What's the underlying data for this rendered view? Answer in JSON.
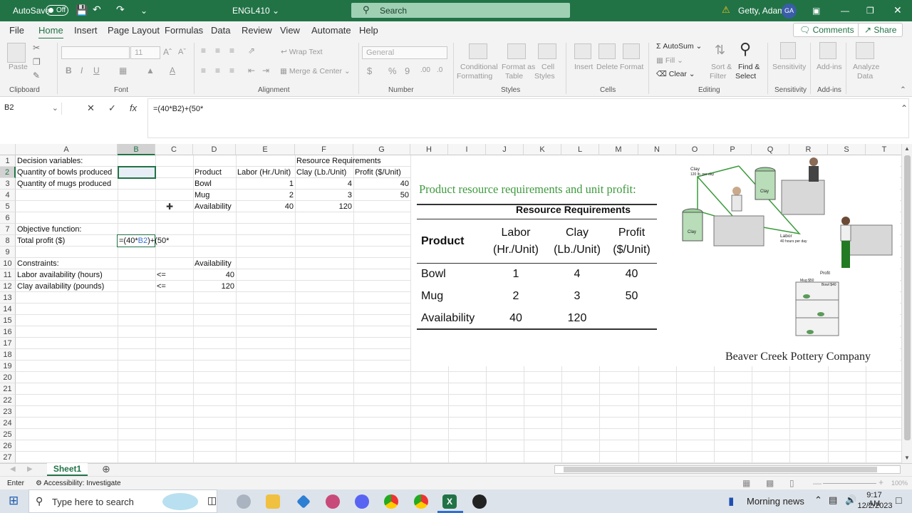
{
  "titlebar": {
    "autosave_label": "AutoSave",
    "autosave_state": "Off",
    "filename": "ENGL410",
    "search_placeholder": "Search",
    "user_name": "Getty, Adam",
    "user_initials": "GA"
  },
  "menu": {
    "items": [
      "File",
      "Home",
      "Insert",
      "Page Layout",
      "Formulas",
      "Data",
      "Review",
      "View",
      "Automate",
      "Help"
    ],
    "active": "Home",
    "comments": "Comments",
    "share": "Share"
  },
  "ribbon": {
    "clipboard": {
      "paste": "Paste",
      "group": "Clipboard"
    },
    "font": {
      "size": "11",
      "group": "Font"
    },
    "alignment": {
      "wrap": "Wrap Text",
      "merge": "Merge & Center",
      "group": "Alignment"
    },
    "number": {
      "format": "General",
      "group": "Number"
    },
    "styles": {
      "conditional": "Conditional",
      "conditional2": "Formatting",
      "format_as": "Format as",
      "format_as2": "Table",
      "cell_styles": "Cell",
      "cell_styles2": "Styles",
      "group": "Styles"
    },
    "cells": {
      "insert": "Insert",
      "delete": "Delete",
      "format": "Format",
      "group": "Cells"
    },
    "editing": {
      "autosum": "AutoSum",
      "fill": "Fill",
      "clear": "Clear",
      "sort": "Sort &",
      "sort2": "Filter",
      "find": "Find &",
      "find2": "Select",
      "group": "Editing"
    },
    "sensitivity": {
      "label": "Sensitivity",
      "group": "Sensitivity"
    },
    "addins": {
      "label": "Add-ins",
      "group": "Add-ins"
    },
    "analyze": {
      "label": "Analyze",
      "label2": "Data"
    }
  },
  "formula_bar": {
    "name_box": "B2",
    "formula": "=(40*B2)+(50*"
  },
  "columns": [
    "A",
    "B",
    "C",
    "D",
    "E",
    "F",
    "G",
    "H",
    "I",
    "J",
    "K",
    "L",
    "M",
    "N",
    "O",
    "P",
    "Q",
    "R",
    "S",
    "T"
  ],
  "rows": [
    "1",
    "2",
    "3",
    "4",
    "5",
    "6",
    "7",
    "8",
    "9",
    "10",
    "11",
    "12",
    "13",
    "14",
    "15",
    "16",
    "17",
    "18",
    "19",
    "20",
    "21",
    "22",
    "23",
    "24",
    "25",
    "26",
    "27"
  ],
  "cells": {
    "A1": "Decision variables:",
    "A2": "Quantity of bowls produced",
    "A3": "Quantity of mugs produced",
    "A7": "Objective function:",
    "A8": "Total profit ($)",
    "B8_pre": "=(40*",
    "B8_ref": "B2",
    "B8_post": ")+(50*",
    "A10": "Constraints:",
    "A11": "Labor availability (hours)",
    "A12": "Clay availability (pounds)",
    "C11": "<=",
    "C12": "<=",
    "D10": "Availability",
    "D11": "40",
    "D12": "120",
    "E1": "Resource Requirements",
    "D2": "Product",
    "E2": "Labor (Hr./Unit)",
    "F2": "Clay (Lb./Unit)",
    "G2": "Profit ($/Unit)",
    "D3": "Bowl",
    "E3": "1",
    "F3": "4",
    "G3": "40",
    "D4": "Mug",
    "E4": "2",
    "F4": "3",
    "G4": "50",
    "D5": "Availability",
    "E5": "40",
    "F5": "120"
  },
  "picture": {
    "heading": "Product resource requirements and unit profit:",
    "table_title": "Resource Requirements",
    "h_product": "Product",
    "h_labor1": "Labor",
    "h_labor2": "(Hr./Unit)",
    "h_clay1": "Clay",
    "h_clay2": "(Lb./Unit)",
    "h_profit1": "Profit",
    "h_profit2": "($/Unit)",
    "rows": [
      {
        "p": "Bowl",
        "l": "1",
        "c": "4",
        "pr": "40"
      },
      {
        "p": "Mug",
        "l": "2",
        "c": "3",
        "pr": "50"
      },
      {
        "p": "Availability",
        "l": "40",
        "c": "120",
        "pr": ""
      }
    ],
    "company": "Beaver Creek Pottery Company",
    "clay_label": "Clay",
    "clay_sub": "120 lb. per day",
    "labor_label": "Labor",
    "labor_sub": "40 hours per day",
    "profit_label": "Profit",
    "mug_tag": "Mug $50",
    "bowl_tag": "Bowl $40"
  },
  "sheet_tabs": {
    "active": "Sheet1"
  },
  "status": {
    "mode": "Enter",
    "accessibility": "Accessibility: Investigate",
    "zoom": "100%"
  },
  "taskbar": {
    "search_placeholder": "Type here to search",
    "news": "Morning news",
    "time": "9:17 AM",
    "date": "12/2/2023"
  },
  "colors": {
    "excel_green": "#217346",
    "selection": "#217346"
  }
}
